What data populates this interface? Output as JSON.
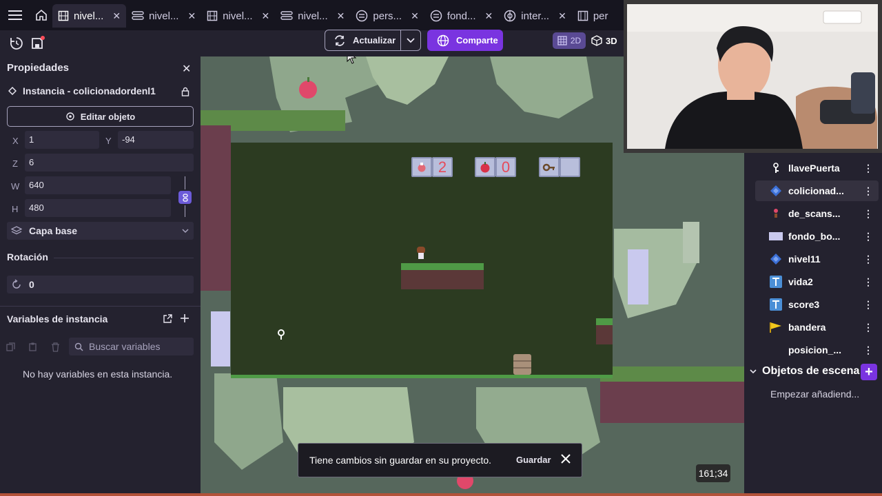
{
  "tabs": [
    {
      "label": "nivel...",
      "icon": "scene-icon",
      "active": true
    },
    {
      "label": "nivel...",
      "icon": "layers-icon",
      "active": false
    },
    {
      "label": "nivel...",
      "icon": "scene-icon",
      "active": false
    },
    {
      "label": "nivel...",
      "icon": "layers-icon",
      "active": false
    },
    {
      "label": "pers...",
      "icon": "events-icon",
      "active": false
    },
    {
      "label": "fond...",
      "icon": "events-icon",
      "active": false
    },
    {
      "label": "inter...",
      "icon": "globe-icon",
      "active": false
    },
    {
      "label": "per",
      "icon": "scene-icon",
      "active": false
    }
  ],
  "toolbar": {
    "update_label": "Actualizar",
    "share_label": "Comparte",
    "view_2d": "2D",
    "view_3d": "3D"
  },
  "properties": {
    "title": "Propiedades",
    "instance_label": "Instancia - colicionadordenl1",
    "edit_object_label": "Editar objeto",
    "x_label": "X",
    "x_value": "1",
    "y_label": "Y",
    "y_value": "-94",
    "z_label": "Z",
    "z_value": "6",
    "w_label": "W",
    "w_value": "640",
    "h_label": "H",
    "h_value": "480",
    "layer_value": "Capa base",
    "rotation_title": "Rotación",
    "rotation_value": "0",
    "variables_title": "Variables de instancia",
    "search_placeholder": "Buscar variables",
    "empty_message": "No hay variables en esta instancia."
  },
  "hud": {
    "counter_1": "2",
    "counter_2": "0"
  },
  "scene": {
    "cursor_coords": "161;34"
  },
  "toast": {
    "message": "Tiene cambios sin guardar en su proyecto.",
    "save_label": "Guardar"
  },
  "objects": {
    "items": [
      {
        "label": "llavePuerta",
        "icon": "key-icon"
      },
      {
        "label": "colicionad...",
        "icon": "tilemap-icon",
        "selected": true
      },
      {
        "label": "de_scans...",
        "icon": "sprite-icon"
      },
      {
        "label": "fondo_bo...",
        "icon": "rectangle-icon"
      },
      {
        "label": "nivel11",
        "icon": "tilemap-icon"
      },
      {
        "label": "vida2",
        "icon": "text-object-icon"
      },
      {
        "label": "score3",
        "icon": "text-object-icon"
      },
      {
        "label": "bandera",
        "icon": "flag-icon"
      },
      {
        "label": "posicion_...",
        "icon": "sprite-icon"
      }
    ],
    "scene_objects_title": "Objetos de escena",
    "scene_objects_hint": "Empezar añadiend..."
  },
  "colors": {
    "accent": "#7a34e0",
    "panel": "#24222f",
    "background": "#1f1d2b"
  }
}
